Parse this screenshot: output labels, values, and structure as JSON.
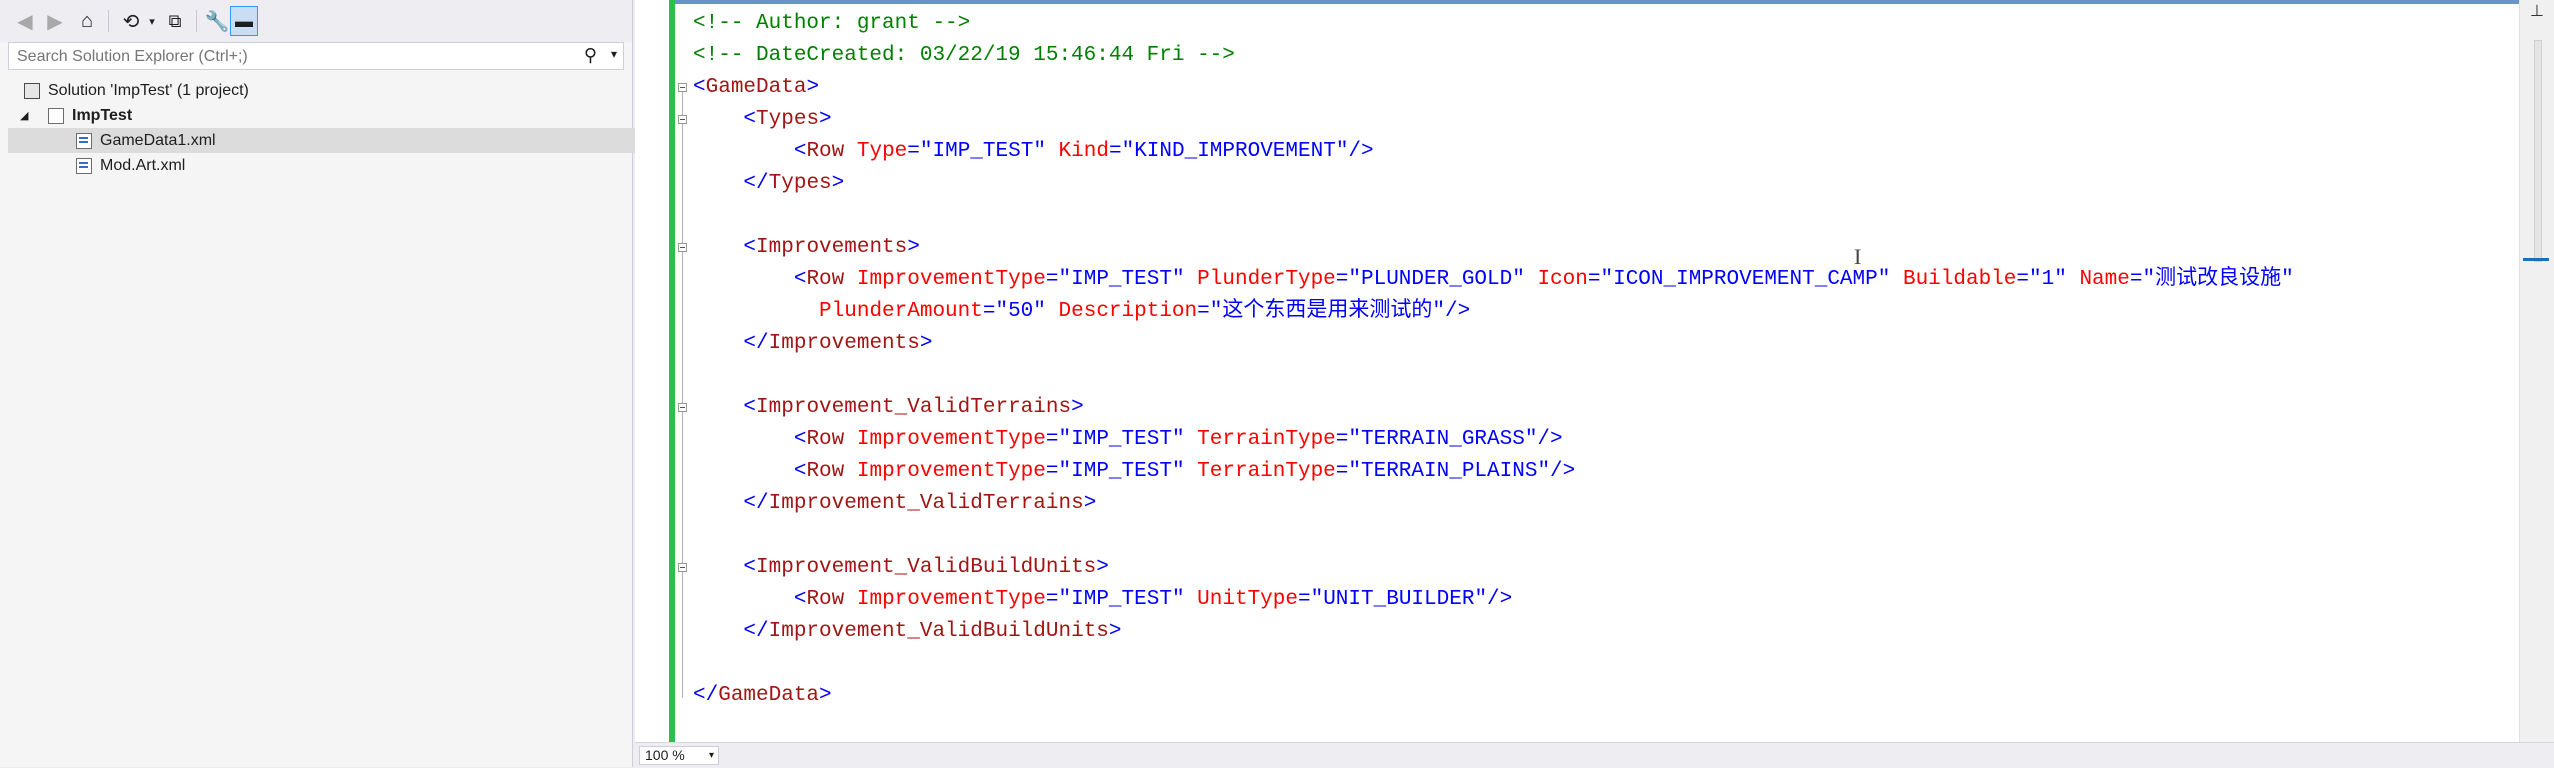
{
  "solution_explorer": {
    "search_placeholder": "Search Solution Explorer (Ctrl+;)",
    "items": [
      {
        "label": "Solution 'ImpTest' (1 project)"
      },
      {
        "label": "ImpTest"
      },
      {
        "label": "GameData1.xml"
      },
      {
        "label": "Mod.Art.xml"
      }
    ]
  },
  "toolbar": {
    "icons": [
      "back-icon",
      "forward-icon",
      "home-icon",
      "history-icon",
      "dropdown-icon",
      "collapse-all-icon",
      "properties-icon",
      "preview-icon"
    ]
  },
  "editor": {
    "zoom": "100 %",
    "lines": [
      [
        {
          "c": "com",
          "t": "<!-- Author: grant -->"
        }
      ],
      [
        {
          "c": "com",
          "t": "<!-- DateCreated: 03/22/19 15:46:44 Fri -->"
        }
      ],
      [
        {
          "c": "pun",
          "t": "<"
        },
        {
          "c": "tag",
          "t": "GameData"
        },
        {
          "c": "pun",
          "t": ">"
        }
      ],
      [
        {
          "c": "plain",
          "t": "    "
        },
        {
          "c": "pun",
          "t": "<"
        },
        {
          "c": "tag",
          "t": "Types"
        },
        {
          "c": "pun",
          "t": ">"
        }
      ],
      [
        {
          "c": "plain",
          "t": "        "
        },
        {
          "c": "pun",
          "t": "<"
        },
        {
          "c": "tag",
          "t": "Row"
        },
        {
          "c": "plain",
          "t": " "
        },
        {
          "c": "att",
          "t": "Type"
        },
        {
          "c": "pun",
          "t": "=\""
        },
        {
          "c": "val",
          "t": "IMP_TEST"
        },
        {
          "c": "pun",
          "t": "\""
        },
        {
          "c": "plain",
          "t": " "
        },
        {
          "c": "att",
          "t": "Kind"
        },
        {
          "c": "pun",
          "t": "=\""
        },
        {
          "c": "val",
          "t": "KIND_IMPROVEMENT"
        },
        {
          "c": "pun",
          "t": "\"/>"
        }
      ],
      [
        {
          "c": "plain",
          "t": "    "
        },
        {
          "c": "pun",
          "t": "</"
        },
        {
          "c": "tag",
          "t": "Types"
        },
        {
          "c": "pun",
          "t": ">"
        }
      ],
      [],
      [
        {
          "c": "plain",
          "t": "    "
        },
        {
          "c": "pun",
          "t": "<"
        },
        {
          "c": "tag",
          "t": "Improvements"
        },
        {
          "c": "pun",
          "t": ">"
        }
      ],
      [
        {
          "c": "plain",
          "t": "        "
        },
        {
          "c": "pun",
          "t": "<"
        },
        {
          "c": "tag",
          "t": "Row"
        },
        {
          "c": "plain",
          "t": " "
        },
        {
          "c": "att",
          "t": "ImprovementType"
        },
        {
          "c": "pun",
          "t": "=\""
        },
        {
          "c": "val",
          "t": "IMP_TEST"
        },
        {
          "c": "pun",
          "t": "\""
        },
        {
          "c": "plain",
          "t": " "
        },
        {
          "c": "att",
          "t": "PlunderType"
        },
        {
          "c": "pun",
          "t": "=\""
        },
        {
          "c": "val",
          "t": "PLUNDER_GOLD"
        },
        {
          "c": "pun",
          "t": "\""
        },
        {
          "c": "plain",
          "t": " "
        },
        {
          "c": "att",
          "t": "Icon"
        },
        {
          "c": "pun",
          "t": "=\""
        },
        {
          "c": "val",
          "t": "ICON_IMPROVEMENT_CAMP"
        },
        {
          "c": "pun",
          "t": "\""
        },
        {
          "c": "plain",
          "t": " "
        },
        {
          "c": "att",
          "t": "Buildable"
        },
        {
          "c": "pun",
          "t": "=\""
        },
        {
          "c": "val",
          "t": "1"
        },
        {
          "c": "pun",
          "t": "\""
        },
        {
          "c": "plain",
          "t": " "
        },
        {
          "c": "att",
          "t": "Name"
        },
        {
          "c": "pun",
          "t": "=\""
        },
        {
          "c": "val",
          "t": "测试改良设施"
        },
        {
          "c": "pun",
          "t": "\""
        }
      ],
      [
        {
          "c": "plain",
          "t": "          "
        },
        {
          "c": "att",
          "t": "PlunderAmount"
        },
        {
          "c": "pun",
          "t": "=\""
        },
        {
          "c": "val",
          "t": "50"
        },
        {
          "c": "pun",
          "t": "\""
        },
        {
          "c": "plain",
          "t": " "
        },
        {
          "c": "att",
          "t": "Description"
        },
        {
          "c": "pun",
          "t": "=\""
        },
        {
          "c": "val",
          "t": "这个东西是用来测试的"
        },
        {
          "c": "pun",
          "t": "\"/>"
        }
      ],
      [
        {
          "c": "plain",
          "t": "    "
        },
        {
          "c": "pun",
          "t": "</"
        },
        {
          "c": "tag",
          "t": "Improvements"
        },
        {
          "c": "pun",
          "t": ">"
        }
      ],
      [],
      [
        {
          "c": "plain",
          "t": "    "
        },
        {
          "c": "pun",
          "t": "<"
        },
        {
          "c": "tag",
          "t": "Improvement_ValidTerrains"
        },
        {
          "c": "pun",
          "t": ">"
        }
      ],
      [
        {
          "c": "plain",
          "t": "        "
        },
        {
          "c": "pun",
          "t": "<"
        },
        {
          "c": "tag",
          "t": "Row"
        },
        {
          "c": "plain",
          "t": " "
        },
        {
          "c": "att",
          "t": "ImprovementType"
        },
        {
          "c": "pun",
          "t": "=\""
        },
        {
          "c": "val",
          "t": "IMP_TEST"
        },
        {
          "c": "pun",
          "t": "\""
        },
        {
          "c": "plain",
          "t": " "
        },
        {
          "c": "att",
          "t": "TerrainType"
        },
        {
          "c": "pun",
          "t": "=\""
        },
        {
          "c": "val",
          "t": "TERRAIN_GRASS"
        },
        {
          "c": "pun",
          "t": "\"/>"
        }
      ],
      [
        {
          "c": "plain",
          "t": "        "
        },
        {
          "c": "pun",
          "t": "<"
        },
        {
          "c": "tag",
          "t": "Row"
        },
        {
          "c": "plain",
          "t": " "
        },
        {
          "c": "att",
          "t": "ImprovementType"
        },
        {
          "c": "pun",
          "t": "=\""
        },
        {
          "c": "val",
          "t": "IMP_TEST"
        },
        {
          "c": "pun",
          "t": "\""
        },
        {
          "c": "plain",
          "t": " "
        },
        {
          "c": "att",
          "t": "TerrainType"
        },
        {
          "c": "pun",
          "t": "=\""
        },
        {
          "c": "val",
          "t": "TERRAIN_PLAINS"
        },
        {
          "c": "pun",
          "t": "\"/>"
        }
      ],
      [
        {
          "c": "plain",
          "t": "    "
        },
        {
          "c": "pun",
          "t": "</"
        },
        {
          "c": "tag",
          "t": "Improvement_ValidTerrains"
        },
        {
          "c": "pun",
          "t": ">"
        }
      ],
      [],
      [
        {
          "c": "plain",
          "t": "    "
        },
        {
          "c": "pun",
          "t": "<"
        },
        {
          "c": "tag",
          "t": "Improvement_ValidBuildUnits"
        },
        {
          "c": "pun",
          "t": ">"
        }
      ],
      [
        {
          "c": "plain",
          "t": "        "
        },
        {
          "c": "pun",
          "t": "<"
        },
        {
          "c": "tag",
          "t": "Row"
        },
        {
          "c": "plain",
          "t": " "
        },
        {
          "c": "att",
          "t": "ImprovementType"
        },
        {
          "c": "pun",
          "t": "=\""
        },
        {
          "c": "val",
          "t": "IMP_TEST"
        },
        {
          "c": "pun",
          "t": "\""
        },
        {
          "c": "plain",
          "t": " "
        },
        {
          "c": "att",
          "t": "UnitType"
        },
        {
          "c": "pun",
          "t": "=\""
        },
        {
          "c": "val",
          "t": "UNIT_BUILDER"
        },
        {
          "c": "pun",
          "t": "\"/>"
        }
      ],
      [
        {
          "c": "plain",
          "t": "    "
        },
        {
          "c": "pun",
          "t": "</"
        },
        {
          "c": "tag",
          "t": "Improvement_ValidBuildUnits"
        },
        {
          "c": "pun",
          "t": ">"
        }
      ],
      [],
      [
        {
          "c": "pun",
          "t": "</"
        },
        {
          "c": "tag",
          "t": "GameData"
        },
        {
          "c": "pun",
          "t": ">"
        }
      ]
    ]
  },
  "colors": {
    "comment": "#008000",
    "tag": "#a31515",
    "punctuation": "#0000ff",
    "attribute": "#ff0000",
    "value": "#0000ff",
    "change_bar": "#2dbe4e"
  }
}
